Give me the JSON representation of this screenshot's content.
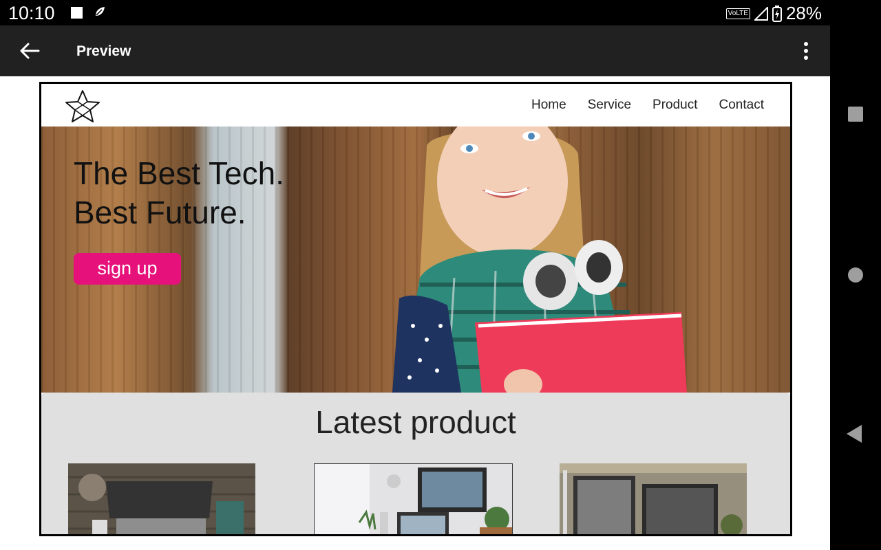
{
  "status_bar": {
    "time": "10:10",
    "network": "VoLTE",
    "battery": "28%"
  },
  "app_bar": {
    "title": "Preview"
  },
  "site": {
    "nav": [
      "Home",
      "Service",
      "Product",
      "Contact"
    ],
    "hero": {
      "line1": "The Best Tech.",
      "line2": "Best Future.",
      "cta": "sign up"
    },
    "latest_title": "Latest product"
  },
  "colors": {
    "accent": "#e6117a",
    "app_bar": "#212121",
    "section_bg": "#e0e0e0"
  }
}
